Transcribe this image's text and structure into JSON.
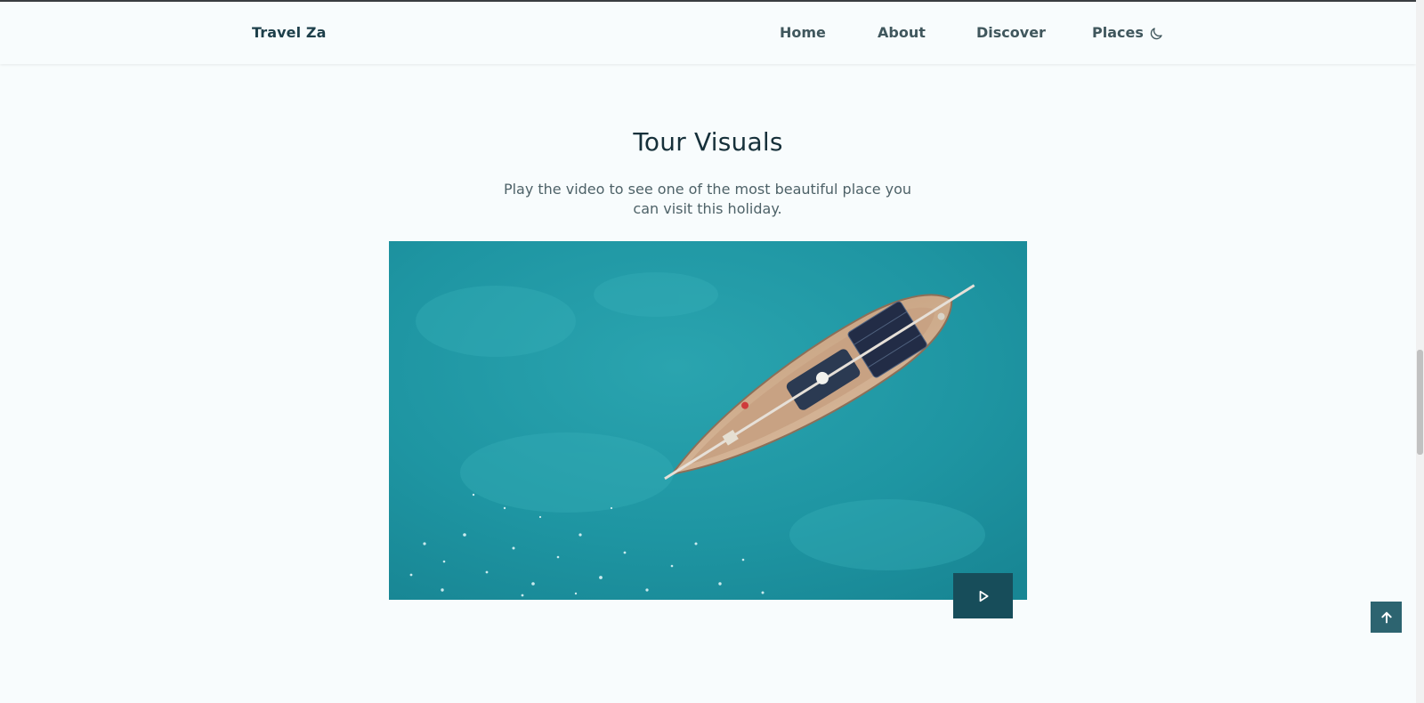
{
  "header": {
    "brand": "Travel Za",
    "nav": [
      {
        "label": "Home"
      },
      {
        "label": "About"
      },
      {
        "label": "Discover"
      },
      {
        "label": "Places"
      }
    ],
    "theme_icon": "moon-icon"
  },
  "section": {
    "title": "Tour Visuals",
    "description": "Play the video to see one of the most beautiful place you can visit this holiday."
  },
  "video": {
    "subject": "aerial-sailboat-on-turquoise-sea",
    "play_icon": "play-icon"
  },
  "scroll_top_icon": "arrow-up-icon",
  "colors": {
    "background": "#f8fcfd",
    "heading": "#16303a",
    "text": "#4e6268",
    "accent_dark": "#174d5a",
    "accent": "#2d6470",
    "sea": "#1f96a3"
  }
}
